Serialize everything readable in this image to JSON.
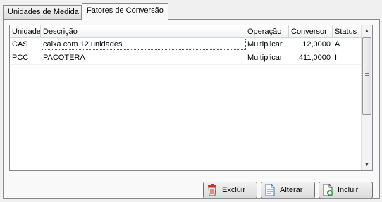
{
  "tabs": [
    {
      "label": "Unidades de Medida"
    },
    {
      "label": "Fatores de Conversão"
    }
  ],
  "grid": {
    "columns": [
      "Unidade",
      "Descrição",
      "Operação",
      "Conversor",
      "Status"
    ],
    "rows": [
      {
        "unidade": "CAS",
        "descricao": "caixa com 12 unidades",
        "operacao": "Multiplicar",
        "conversor": "12,0000",
        "status": "A"
      },
      {
        "unidade": "PCC",
        "descricao": "PACOTERA",
        "operacao": "Multiplicar",
        "conversor": "411,0000",
        "status": "I"
      }
    ]
  },
  "buttons": {
    "excluir": "Excluir",
    "alterar": "Alterar",
    "incluir": "Incluir"
  },
  "icons": {
    "excluir": "trash-icon",
    "alterar": "document-edit-icon",
    "incluir": "document-add-icon"
  },
  "colors": {
    "trash": "#c0392b",
    "add": "#2e9e3f",
    "doc": "#3a6fb7"
  }
}
